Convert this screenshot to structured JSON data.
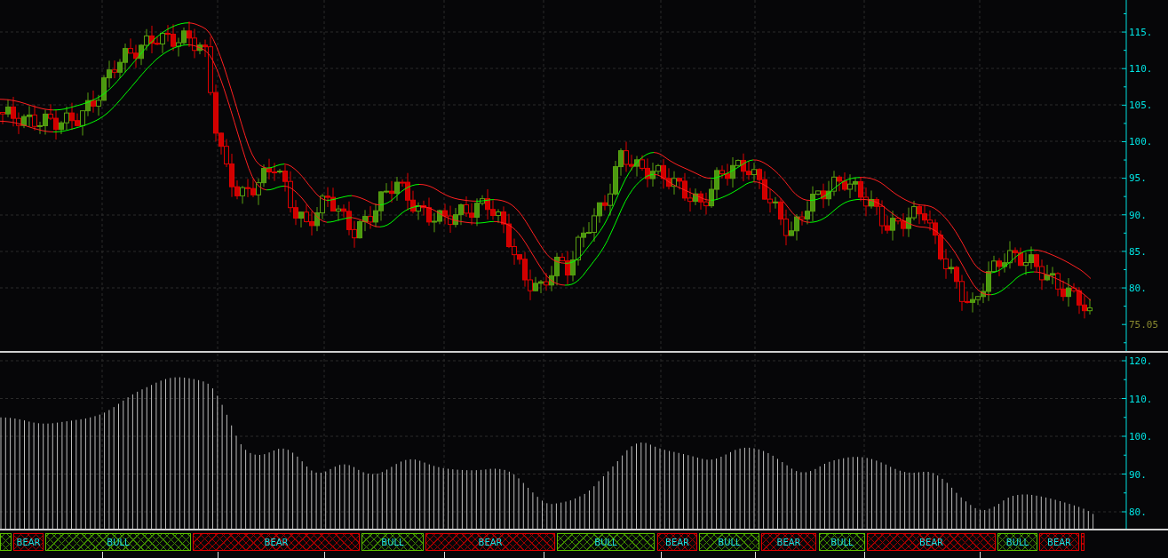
{
  "price_chart": {
    "y_axis_labels": [
      "115.",
      "110.",
      "105.",
      "100.",
      "95.",
      "90.",
      "85.",
      "80."
    ],
    "last_price": "75.05"
  },
  "indicator_panel": {
    "y_axis_labels": [
      "120.",
      "110.",
      "100.",
      "90.",
      "80."
    ]
  },
  "trend_band": {
    "segments": [
      {
        "kind": "bull"
      },
      {
        "kind": "bear",
        "label": "BEAR"
      },
      {
        "kind": "bull",
        "label": "BULL"
      },
      {
        "kind": "bear",
        "label": "BEAR"
      },
      {
        "kind": "bull",
        "label": "BULL"
      },
      {
        "kind": "bear",
        "label": "BEAR"
      },
      {
        "kind": "bull",
        "label": "BULL"
      },
      {
        "kind": "bear",
        "label": "BEAR"
      },
      {
        "kind": "bull",
        "label": "BULL"
      },
      {
        "kind": "bear",
        "label": "BEAR"
      },
      {
        "kind": "bull",
        "label": "BULL"
      },
      {
        "kind": "bear",
        "label": "BEAR"
      },
      {
        "kind": "bull",
        "label": "BULL"
      },
      {
        "kind": "bear",
        "label": "BEAR"
      },
      {
        "kind": "bear"
      }
    ]
  }
}
